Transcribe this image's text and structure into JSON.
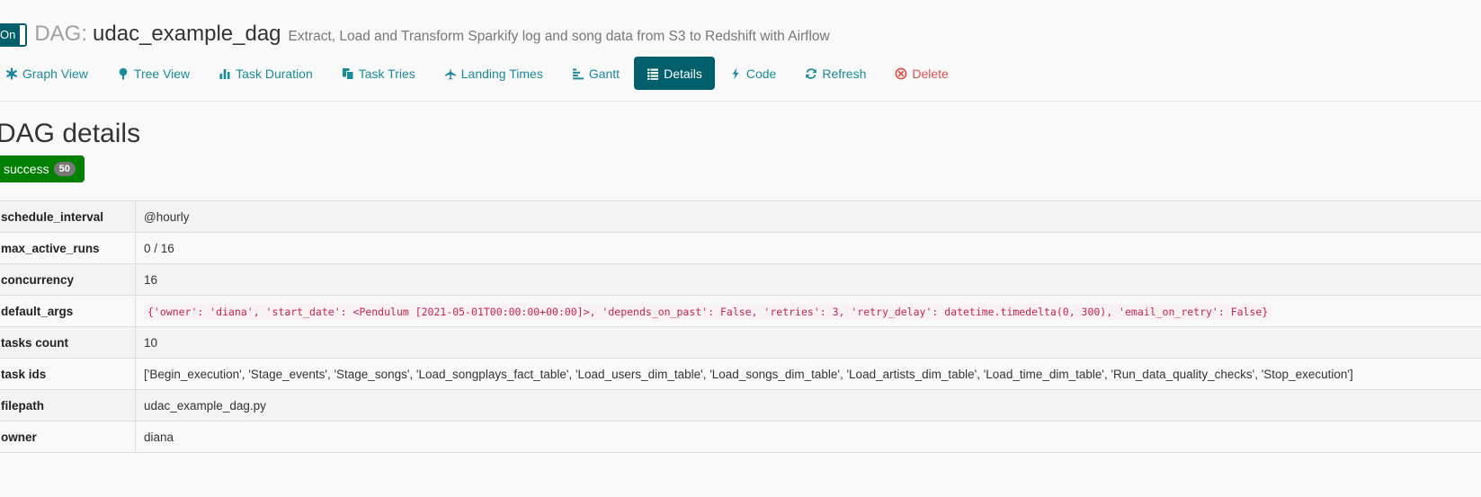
{
  "header": {
    "toggle_label": "On",
    "dag_label": "DAG:",
    "dag_id": "udac_example_dag",
    "description": "Extract, Load and Transform Sparkify log and song data from S3 to Redshift with Airflow"
  },
  "nav": [
    {
      "label": "Graph View",
      "icon": "asterisk-icon"
    },
    {
      "label": "Tree View",
      "icon": "tree-icon"
    },
    {
      "label": "Task Duration",
      "icon": "bar-chart-icon"
    },
    {
      "label": "Task Tries",
      "icon": "duplicate-icon"
    },
    {
      "label": "Landing Times",
      "icon": "plane-icon"
    },
    {
      "label": "Gantt",
      "icon": "align-left-icon"
    },
    {
      "label": "Details",
      "icon": "list-icon",
      "active": true
    },
    {
      "label": "Code",
      "icon": "flash-icon"
    },
    {
      "label": "Refresh",
      "icon": "refresh-icon"
    },
    {
      "label": "Delete",
      "icon": "remove-circle-icon"
    }
  ],
  "section": {
    "title": "DAG details",
    "state": "success",
    "state_count": "50",
    "state_color": "#008000"
  },
  "details": [
    {
      "key": "schedule_interval",
      "value": "@hourly"
    },
    {
      "key": "max_active_runs",
      "value": "0 / 16"
    },
    {
      "key": "concurrency",
      "value": "16"
    },
    {
      "key": "default_args",
      "value": "{'owner': 'diana', 'start_date': <Pendulum [2021-05-01T00:00:00+00:00]>, 'depends_on_past': False, 'retries': 3, 'retry_delay': datetime.timedelta(0, 300), 'email_on_retry': False}",
      "code": true
    },
    {
      "key": "tasks count",
      "value": "10"
    },
    {
      "key": "task ids",
      "value": "['Begin_execution', 'Stage_events', 'Stage_songs', 'Load_songplays_fact_table', 'Load_users_dim_table', 'Load_songs_dim_table', 'Load_artists_dim_table', 'Load_time_dim_table', 'Run_data_quality_checks', 'Stop_execution']"
    },
    {
      "key": "filepath",
      "value": "udac_example_dag.py"
    },
    {
      "key": "owner",
      "value": "diana"
    }
  ],
  "colors": {
    "accent": "#005f6b",
    "link": "#1a8a9a",
    "danger": "#d9534f",
    "success": "#008000"
  }
}
